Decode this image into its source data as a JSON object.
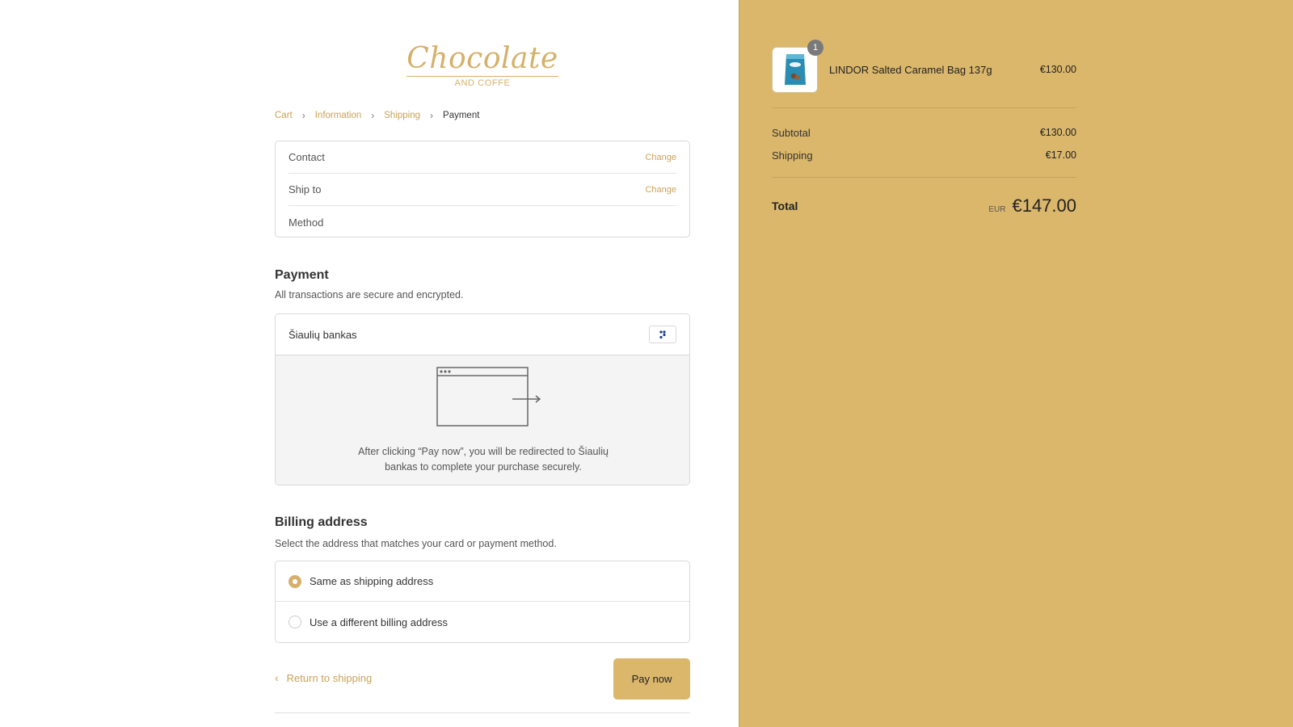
{
  "brand": {
    "logo_main": "Chocolate",
    "logo_sub": "AND COFFE"
  },
  "breadcrumb": {
    "items": [
      {
        "label": "Cart"
      },
      {
        "label": "Information"
      },
      {
        "label": "Shipping"
      },
      {
        "label": "Payment"
      }
    ]
  },
  "review": {
    "rows": [
      {
        "label": "Contact",
        "action": "Change"
      },
      {
        "label": "Ship to",
        "action": "Change"
      },
      {
        "label": "Method"
      }
    ]
  },
  "payment": {
    "title": "Payment",
    "subtitle": "All transactions are secure and encrypted.",
    "method_name": "Šiaulių bankas",
    "redirect_text": "After clicking “Pay now”, you will be redirected to Šiaulių bankas to complete your purchase securely."
  },
  "billing": {
    "title": "Billing address",
    "subtitle": "Select the address that matches your card or payment method.",
    "options": [
      {
        "label": "Same as shipping address",
        "selected": true
      },
      {
        "label": "Use a different billing address",
        "selected": false
      }
    ]
  },
  "actions": {
    "return_label": "Return to shipping",
    "pay_label": "Pay now"
  },
  "order": {
    "item": {
      "name": "LINDOR Salted Caramel Bag 137g",
      "price": "€130.00",
      "quantity": "1"
    },
    "subtotal_label": "Subtotal",
    "subtotal": "€130.00",
    "shipping_label": "Shipping",
    "shipping": "€17.00",
    "total_label": "Total",
    "currency": "EUR",
    "total": "€147.00"
  },
  "colors": {
    "accent": "#d6b06a",
    "sidebar_bg": "#dbb76b",
    "link": "#c9a25a"
  }
}
